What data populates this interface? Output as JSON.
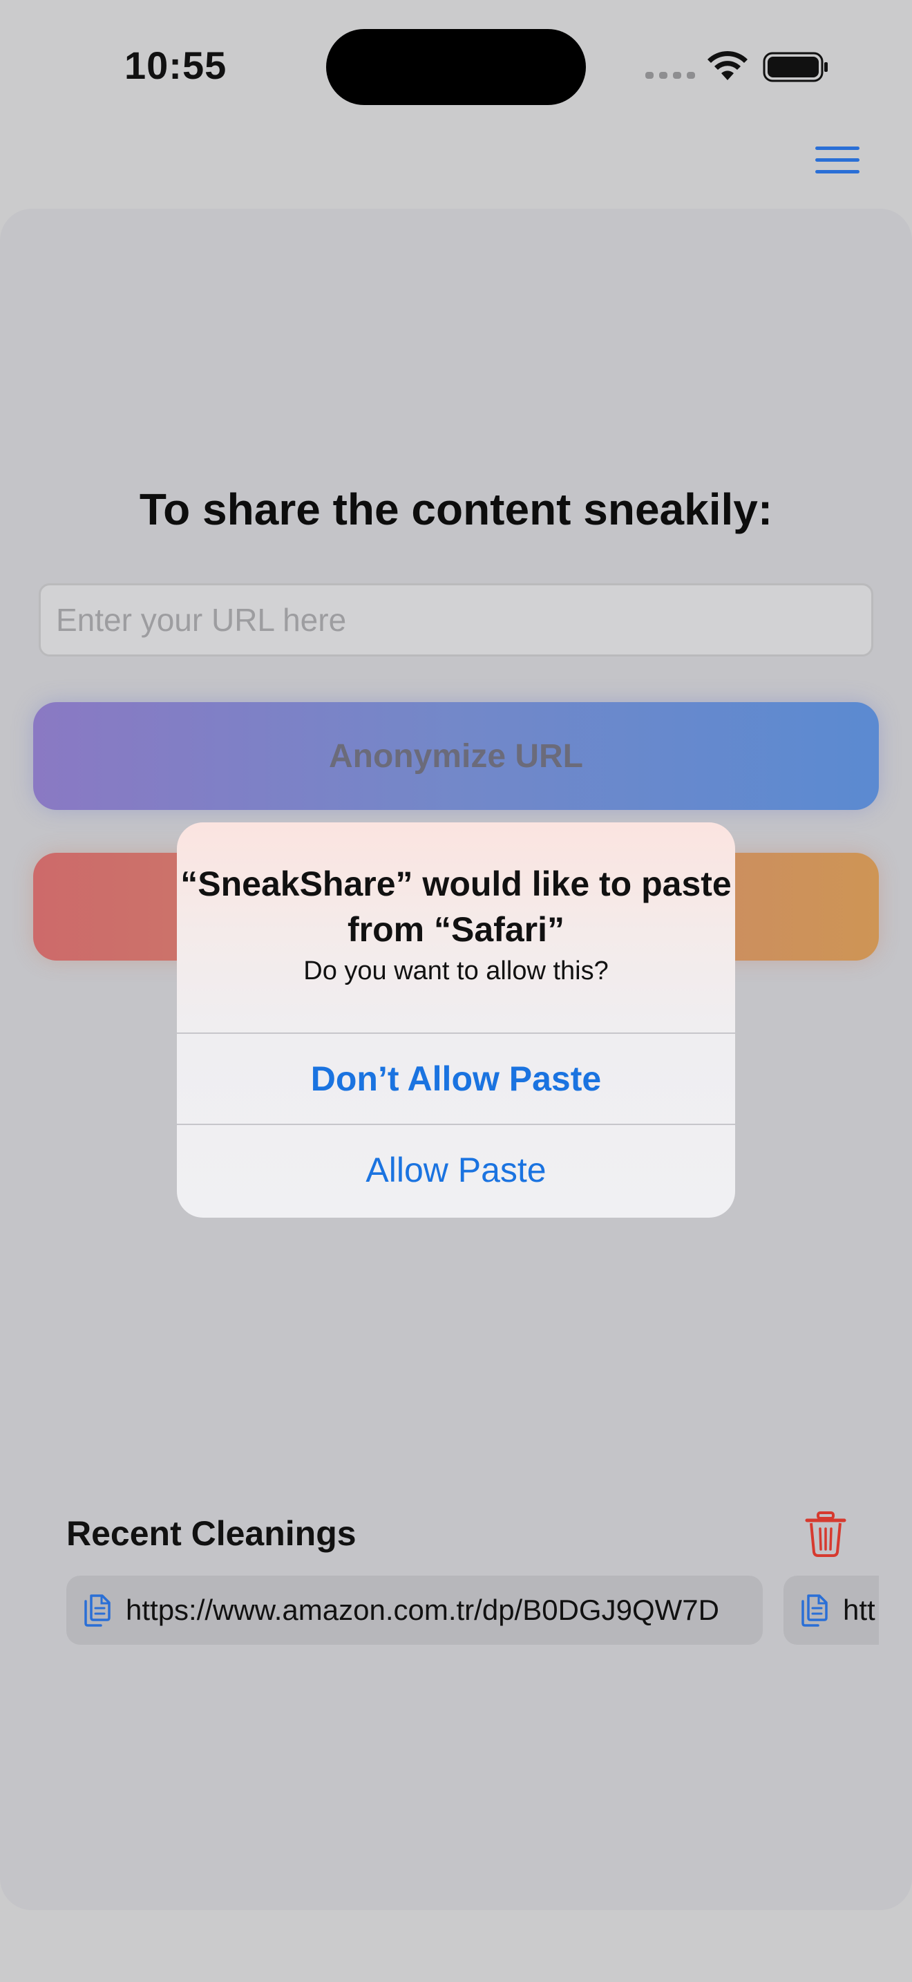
{
  "status_bar": {
    "time": "10:55"
  },
  "main": {
    "headline": "To share the content sneakily:",
    "url_placeholder": "Enter your URL here",
    "anonymize_label": "Anonymize URL"
  },
  "recent": {
    "title": "Recent Cleanings",
    "items": [
      {
        "url": "https://www.amazon.com.tr/dp/B0DGJ9QW7D"
      },
      {
        "url": "htt"
      }
    ]
  },
  "alert": {
    "title": "“SneakShare” would like to paste from “Safari”",
    "message": "Do you want to allow this?",
    "deny_label": "Don’t Allow Paste",
    "allow_label": "Allow Paste"
  },
  "colors": {
    "accent_blue": "#1a73e0",
    "trash_red": "#d63a2f",
    "menu_blue": "#2a6fd6"
  }
}
